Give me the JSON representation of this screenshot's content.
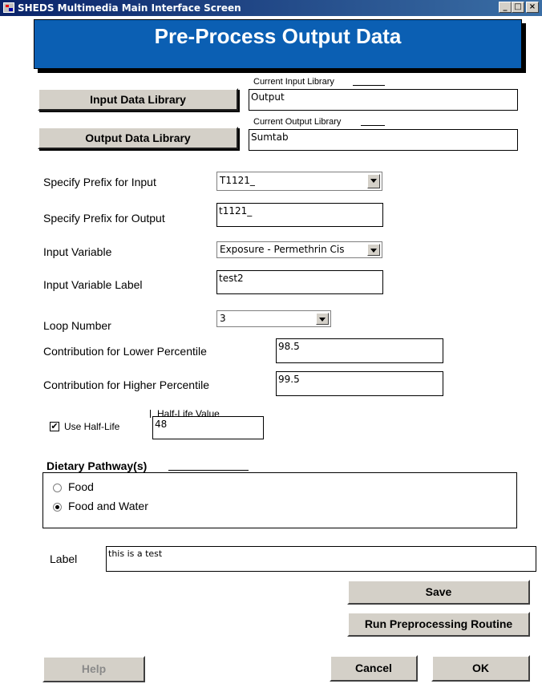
{
  "window": {
    "title": "SHEDS Multimedia Main Interface Screen",
    "minimize": "_",
    "maximize": "□",
    "close": "×"
  },
  "header": {
    "title": "Pre-Process Output Data"
  },
  "libraries": {
    "input_button": "Input Data Library",
    "input_caption": "Current Input Library",
    "input_value": "Output",
    "output_button": "Output Data Library",
    "output_caption": "Current Output Library",
    "output_value": "Sumtab"
  },
  "form": {
    "prefix_input_label": "Specify Prefix for Input",
    "prefix_input_value": "T1121_",
    "prefix_output_label": "Specify Prefix for Output",
    "prefix_output_value": "t1121_",
    "input_variable_label": "Input Variable",
    "input_variable_value": "Exposure - Permethrin Cis",
    "input_variable_label_label": "Input Variable Label",
    "input_variable_label_value": "test2",
    "loop_number_label": "Loop Number",
    "loop_number_value": "3",
    "lower_pct_label": "Contribution for Lower Percentile",
    "lower_pct_value": "98.5",
    "higher_pct_label": "Contribution for Higher Percentile",
    "higher_pct_value": "99.5",
    "half_life_checkbox_label": "Use Half-Life",
    "half_life_checked": true,
    "half_life_caption": "Half-Life Value",
    "half_life_value": "48"
  },
  "dietary": {
    "title": "Dietary Pathway(s)",
    "options": [
      {
        "label": "Food",
        "selected": false
      },
      {
        "label": "Food and Water",
        "selected": true
      }
    ]
  },
  "label_field": {
    "label": "Label",
    "value": "this is a test"
  },
  "actions": {
    "save": "Save",
    "run": "Run Preprocessing Routine",
    "help": "Help",
    "cancel": "Cancel",
    "ok": "OK"
  }
}
